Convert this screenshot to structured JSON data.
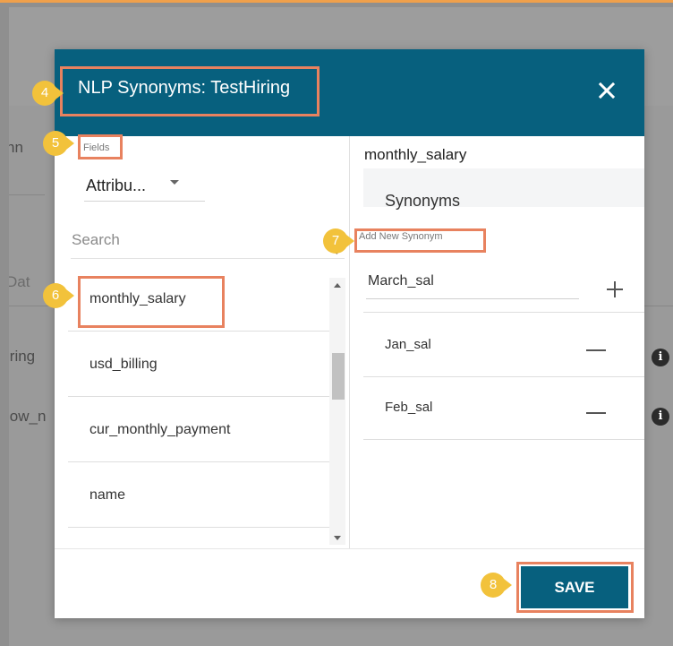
{
  "background": {
    "fragments": [
      "nn",
      "Dat",
      "iring",
      "low_n"
    ]
  },
  "dialog": {
    "title": "NLP Synonyms: TestHiring",
    "close_icon": "close-icon"
  },
  "fields_panel": {
    "label": "Fields",
    "dropdown_value": "Attribu...",
    "search_placeholder": "Search",
    "items": [
      {
        "label": "monthly_salary"
      },
      {
        "label": "usd_billing"
      },
      {
        "label": "cur_monthly_payment"
      },
      {
        "label": "name"
      }
    ]
  },
  "synonyms_panel": {
    "field_name": "monthly_salary",
    "tab_label": "Synonyms",
    "add_label": "Add New Synonym",
    "input_value": "March_sal",
    "list": [
      {
        "label": "Jan_sal"
      },
      {
        "label": "Feb_sal"
      }
    ]
  },
  "footer": {
    "save_label": "SAVE"
  },
  "annotations": {
    "steps": [
      "4",
      "5",
      "6",
      "7",
      "8"
    ]
  },
  "colors": {
    "header": "#07607e",
    "highlight": "#e8825f",
    "marker": "#f2c23b"
  }
}
